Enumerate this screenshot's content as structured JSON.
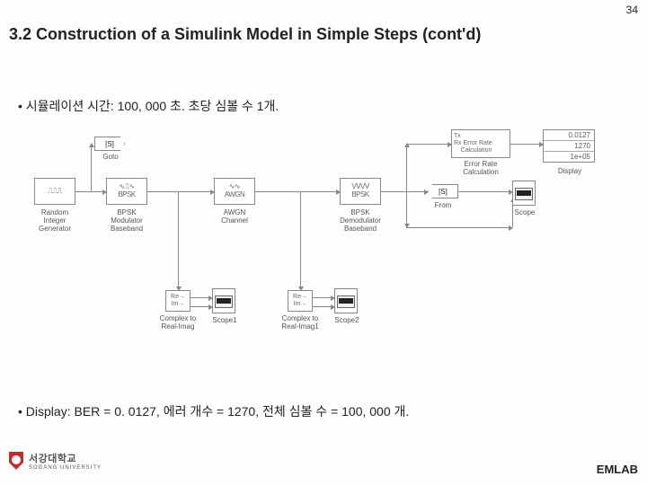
{
  "page_number": "34",
  "heading": "3.2 Construction of a Simulink Model in Simple Steps (cont'd)",
  "bullets": {
    "b1": "시뮬레이션 시간: 100, 000 초. 초당 심볼 수 1개.",
    "b2": "Display: BER = 0. 0127, 에러 개수 = 1270, 전체 심볼 수 = 100, 000 개."
  },
  "footer": {
    "university": "서강대학교",
    "university_en": "SOGANG UNIVERSITY",
    "lab": "EMLAB"
  },
  "blocks": {
    "random": {
      "glyph": "╌╌╌",
      "label": "Random\nInteger\nGenerator"
    },
    "bpsk_mod": {
      "glyph": "BPSK",
      "label": "BPSK\nModulator\nBaseband"
    },
    "awgn": {
      "glyph": "AWGN",
      "label": "AWGN\nChannel"
    },
    "bpsk_demod": {
      "glyph": "BPSK",
      "label": "BPSK\nDemodulator\nBaseband"
    },
    "err": {
      "text": "Tx\nRx  Error Rate\n     Calculation",
      "label": "Error Rate\nCalculation"
    },
    "goto": {
      "tag": "[S]",
      "label": "Goto"
    },
    "from": {
      "tag": "[S]",
      "label": "From"
    },
    "display": {
      "v1": "0.0127",
      "v2": "1270",
      "v3": "1e+05",
      "label": "Display"
    },
    "cri1": {
      "text": "Re\nIm",
      "label": "Complex to\nReal-Imag"
    },
    "cri2": {
      "text": "Re\nIm",
      "label": "Complex to\nReal-Imag1"
    },
    "scope": {
      "label": "Scope"
    },
    "scope1": {
      "label": "Scope1"
    },
    "scope2": {
      "label": "Scope2"
    }
  }
}
